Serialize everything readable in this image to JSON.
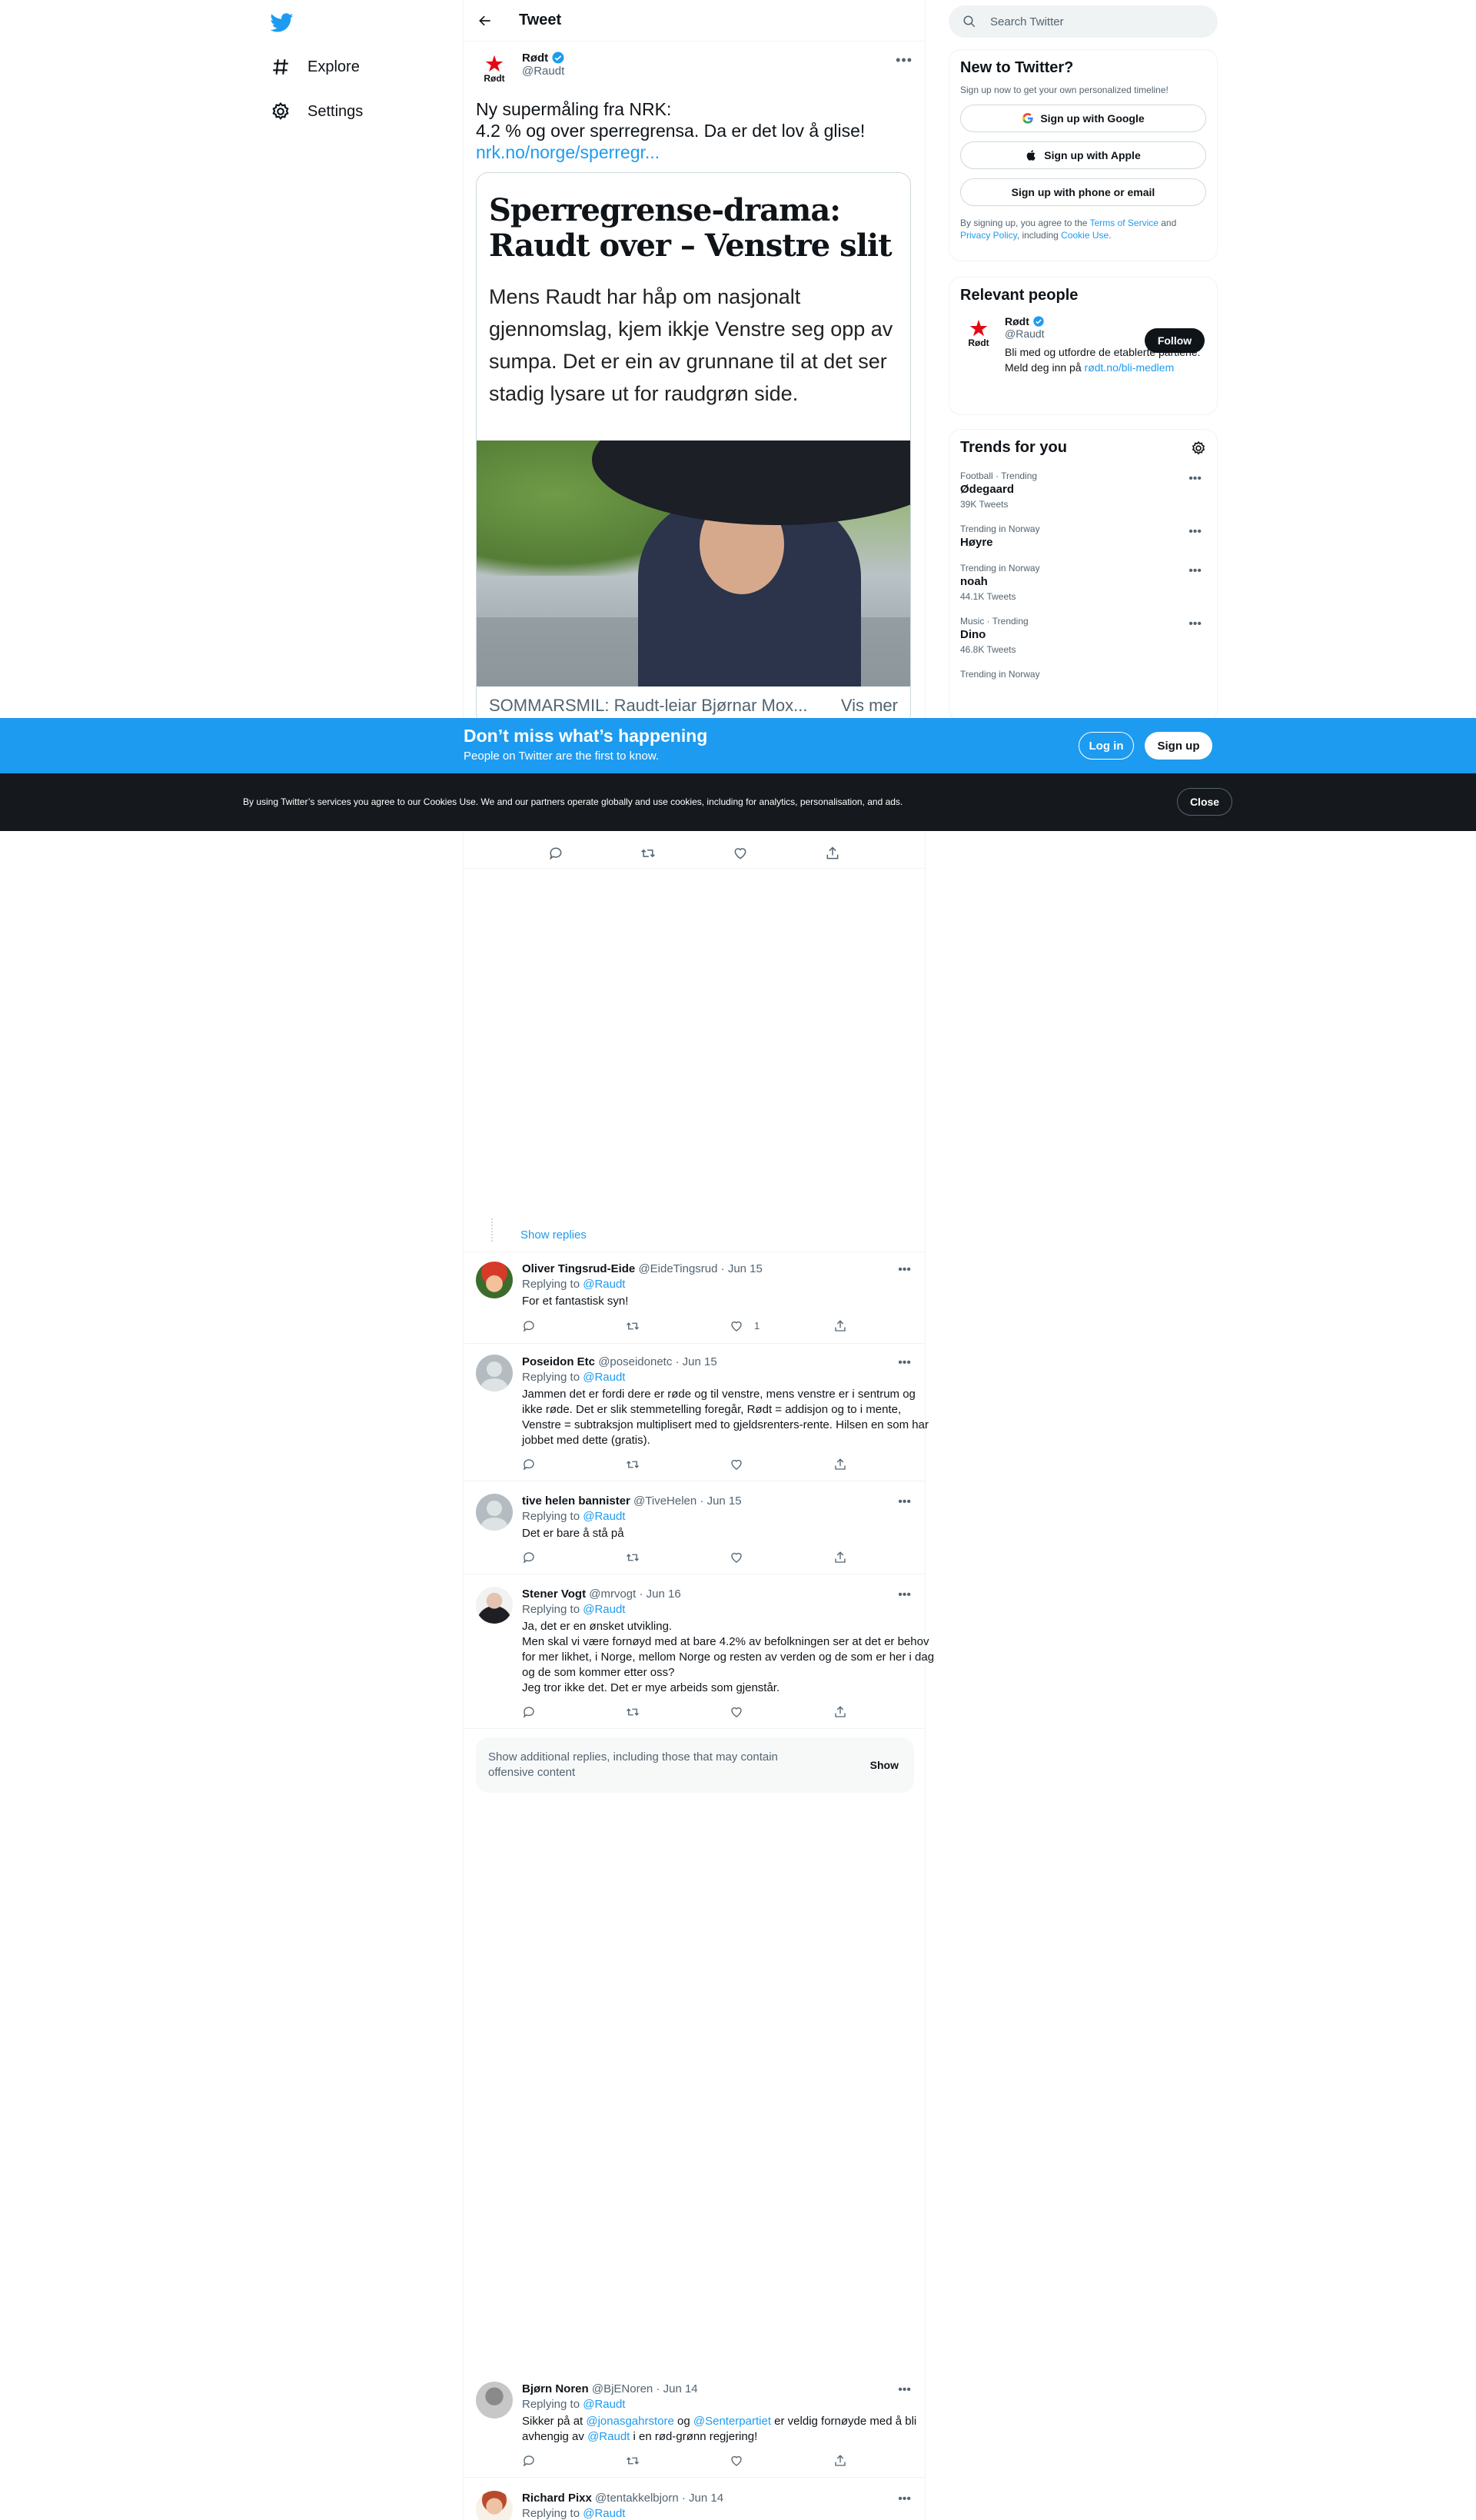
{
  "nav": {
    "explore_label": "Explore",
    "settings_label": "Settings"
  },
  "header": {
    "title": "Tweet"
  },
  "tweet": {
    "author_name": "Rødt",
    "author_handle": "@Raudt",
    "avatar_text": "Rødt",
    "text": "Ny supermåling fra NRK:\n4.2 % og over sperregrensa. Da er det lov å glise!",
    "link": "nrk.no/norge/sperregr...",
    "card": {
      "headline": "Sperregrense-drama: Raudt over – Venstre slit",
      "subtitle": "Mens Raudt har håp om nasjonalt gjennomslag, kjem ikkje Venstre seg opp av sumpa. Det er ein av grunnane til at det ser stadig lysare ut for raudgrøn side.",
      "caption": "SOMMARSMIL: Raudt-leiar Bjørnar Mox...",
      "caption_more": "Vis mer"
    }
  },
  "show_replies": "Show replies",
  "replies": [
    {
      "name": "Oliver Tingsrud-Eide",
      "handle": "@EideTingsrud",
      "date": "· Jun 15",
      "replying": "Replying to",
      "mention": "@Raudt",
      "text": "For et fantastisk syn!",
      "likes": "1"
    },
    {
      "name": "Poseidon Etc",
      "handle": "@poseidonetc",
      "date": "· Jun 15",
      "replying": "Replying to",
      "mention": "@Raudt",
      "text": "Jammen det er fordi dere er røde og til venstre, mens venstre er i sentrum og ikke røde. Det er slik stemmetelling foregår, Rødt = addisjon og to i mente, Venstre = subtraksjon multiplisert med to gjeldsrenters-rente. Hilsen en som har jobbet med dette (gratis)."
    },
    {
      "name": "tive helen bannister",
      "handle": "@TiveHelen",
      "date": "· Jun 15",
      "replying": "Replying to",
      "mention": "@Raudt",
      "text": "Det er bare å stå på"
    },
    {
      "name": "Stener Vogt",
      "handle": "@mrvogt",
      "date": "· Jun 16",
      "replying": "Replying to",
      "mention": "@Raudt",
      "text": "Ja, det er en ønsket utvikling.\nMen skal vi være fornøyd med at bare 4.2% av befolkningen ser at det er behov for mer likhet, i Norge, mellom Norge og resten av verden og de som er her i dag og de som kommer etter oss?\nJeg tror ikke det. Det er mye arbeids som gjenstår."
    },
    {
      "name": "Bjørn Noren",
      "handle": "@BjENoren",
      "date": "· Jun 14",
      "replying": "Replying to",
      "mention": "@Raudt",
      "text_a": "Sikker på at ",
      "m1": "@jonasgahrstore",
      "text_b": " og ",
      "m2": "@Senterpartiet",
      "text_c": "  er veldig fornøyde med å bli avhengig av ",
      "m3": "@Raudt",
      "text_d": " i en rød-grønn regjering!"
    },
    {
      "name": "Richard Pixx",
      "handle": "@tentakkelbjorn",
      "date": "· Jun 14",
      "replying": "Replying to",
      "mention": "@Raudt"
    }
  ],
  "offensive": {
    "text": "Show additional replies, including those that may contain offensive content",
    "button": "Show"
  },
  "sidebar": {
    "search_placeholder": "Search Twitter",
    "new": {
      "title": "New to Twitter?",
      "subtitle": "Sign up now to get your own personalized timeline!",
      "google": "Sign up with Google",
      "apple": "Sign up with Apple",
      "phone": "Sign up with phone or email",
      "terms_a": "By signing up, you agree to the ",
      "terms_link": "Terms of Service",
      "terms_b": " and ",
      "privacy_link": "Privacy Policy",
      "terms_c": ", including ",
      "cookie_link": "Cookie Use",
      "terms_d": "."
    },
    "relevant": {
      "title": "Relevant people",
      "name": "Rødt",
      "handle": "@Raudt",
      "follow": "Follow",
      "bio": "Bli med og utfordre de etablerte partiene: Meld deg inn på ",
      "bio_link": "rødt.no/bli-medlem"
    },
    "trends": {
      "title": "Trends for you",
      "items": [
        {
          "meta": "Football · Trending",
          "name": "Ødegaard",
          "count": "39K Tweets"
        },
        {
          "meta": "Trending in Norway",
          "name": "Høyre",
          "count": ""
        },
        {
          "meta": "Trending in Norway",
          "name": "noah",
          "count": "44.1K Tweets"
        },
        {
          "meta": "Music · Trending",
          "name": "Dino",
          "count": "46.8K Tweets"
        },
        {
          "meta": "Trending in Norway",
          "name": "",
          "count": ""
        }
      ]
    }
  },
  "banner": {
    "title": "Don’t miss what’s happening",
    "subtitle": "People on Twitter are the first to know.",
    "login": "Log in",
    "signup": "Sign up"
  },
  "cookie": {
    "text": "By using Twitter’s services you agree to our Cookies Use. We and our partners operate globally and use cookies, including for analytics, personalisation, and ads.",
    "close": "Close"
  },
  "colors": {
    "accent": "#1d9bf0",
    "text": "#0f1419",
    "muted": "#536471",
    "cookie_bg": "#15191d"
  },
  "icons": [
    "twitter-logo-icon",
    "hashtag-icon",
    "gear-icon",
    "back-arrow-icon",
    "verified-icon",
    "reply-icon",
    "retweet-icon",
    "like-icon",
    "share-icon",
    "search-icon",
    "google-icon",
    "apple-icon",
    "more-icon"
  ]
}
